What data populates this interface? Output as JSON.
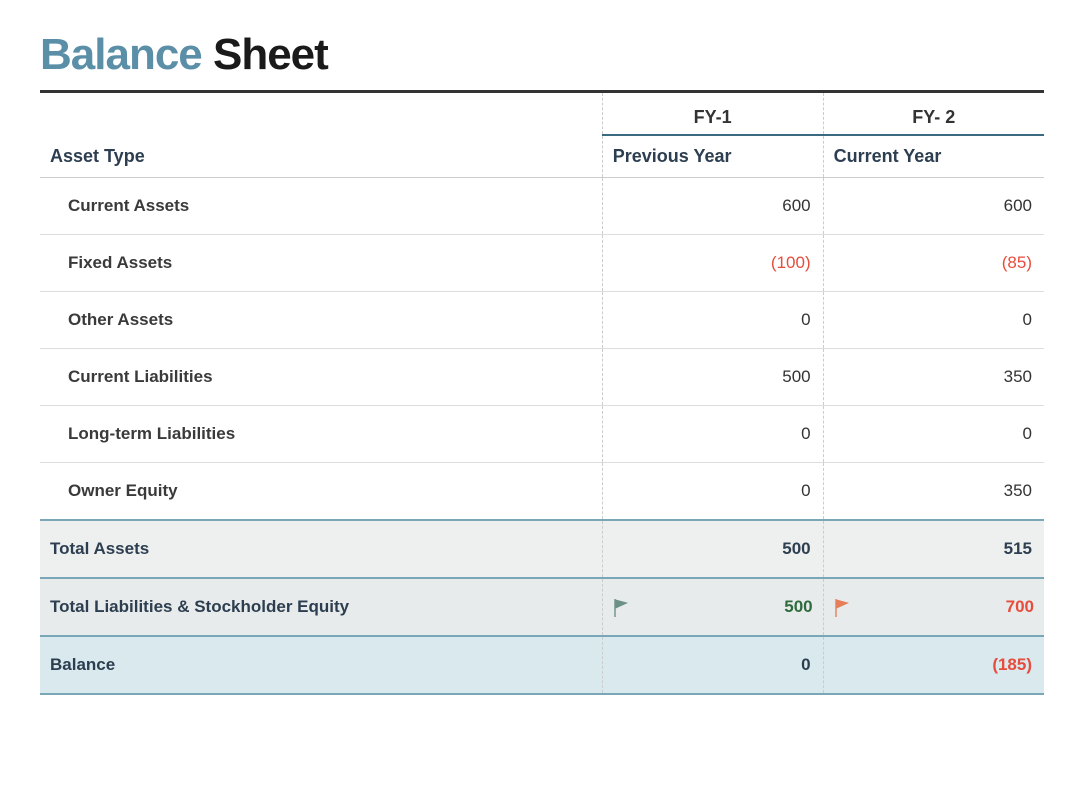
{
  "title": {
    "accent": "Balance",
    "rest": " Sheet"
  },
  "headers": {
    "fy1": "FY-1",
    "fy2": "FY- 2",
    "asset_type": "Asset Type",
    "previous_year": "Previous Year",
    "current_year": "Current Year"
  },
  "rows": [
    {
      "label": "Current Assets",
      "fy1": "600",
      "fy2": "600",
      "neg1": false,
      "neg2": false
    },
    {
      "label": "Fixed Assets",
      "fy1": "(100)",
      "fy2": "(85)",
      "neg1": true,
      "neg2": true
    },
    {
      "label": "Other Assets",
      "fy1": "0",
      "fy2": "0",
      "neg1": false,
      "neg2": false
    },
    {
      "label": "Current Liabilities",
      "fy1": "500",
      "fy2": "350",
      "neg1": false,
      "neg2": false
    },
    {
      "label": "Long-term Liabilities",
      "fy1": "0",
      "fy2": "0",
      "neg1": false,
      "neg2": false
    },
    {
      "label": "Owner Equity",
      "fy1": "0",
      "fy2": "350",
      "neg1": false,
      "neg2": false
    }
  ],
  "total_assets": {
    "label": "Total Assets",
    "fy1": "500",
    "fy2": "515"
  },
  "total_liab": {
    "label": "Total Liabilities & Stockholder Equity",
    "fy1": "500",
    "fy2": "700",
    "flag1": "green",
    "flag2": "red"
  },
  "balance": {
    "label": "Balance",
    "fy1": "0",
    "fy2": "(185)",
    "neg2": true
  }
}
